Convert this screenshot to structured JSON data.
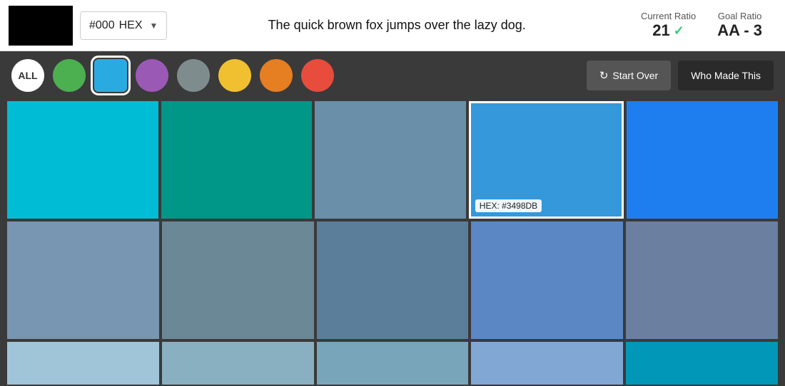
{
  "topbar": {
    "hex_value": "#000",
    "hex_format": "HEX",
    "preview_text": "The quick brown fox jumps over the lazy dog.",
    "current_ratio_label": "Current Ratio",
    "current_ratio_value": "21",
    "goal_ratio_label": "Goal Ratio",
    "goal_ratio_value": "AA - 3"
  },
  "filterbar": {
    "all_label": "ALL",
    "colors": [
      {
        "name": "green",
        "hex": "#4caf50",
        "selected": false
      },
      {
        "name": "blue",
        "hex": "#29abe2",
        "selected": true
      },
      {
        "name": "purple",
        "hex": "#9b59b6",
        "selected": false
      },
      {
        "name": "gray",
        "hex": "#7f8c8d",
        "selected": false
      },
      {
        "name": "yellow",
        "hex": "#f0c030",
        "selected": false
      },
      {
        "name": "orange",
        "hex": "#e67e22",
        "selected": false
      },
      {
        "name": "red",
        "hex": "#e74c3c",
        "selected": false
      }
    ],
    "start_over_label": "Start Over",
    "who_made_label": "Who Made This"
  },
  "grid": {
    "row1": [
      {
        "hex": "#00bcd4",
        "highlighted": false
      },
      {
        "hex": "#009688",
        "highlighted": false
      },
      {
        "hex": "#6a8fa8",
        "highlighted": false
      },
      {
        "hex": "#3498db",
        "highlighted": true,
        "hex_label": "HEX: #3498DB"
      },
      {
        "hex": "#1e7ef0",
        "highlighted": false
      }
    ],
    "row2": [
      {
        "hex": "#7896b2",
        "highlighted": false
      },
      {
        "hex": "#6b8896",
        "highlighted": false
      },
      {
        "hex": "#5b7f9a",
        "highlighted": false
      },
      {
        "hex": "#5b87c5",
        "highlighted": false
      },
      {
        "hex": "#6b7fa0",
        "highlighted": false
      }
    ],
    "row3_partial": [
      {
        "hex": "#a0c4d8",
        "highlighted": false
      },
      {
        "hex": "#89b0c0",
        "highlighted": false
      },
      {
        "hex": "#79a5bb",
        "highlighted": false
      },
      {
        "hex": "#81a8d5",
        "highlighted": false
      },
      {
        "hex": "#0097b8",
        "highlighted": false
      }
    ]
  }
}
